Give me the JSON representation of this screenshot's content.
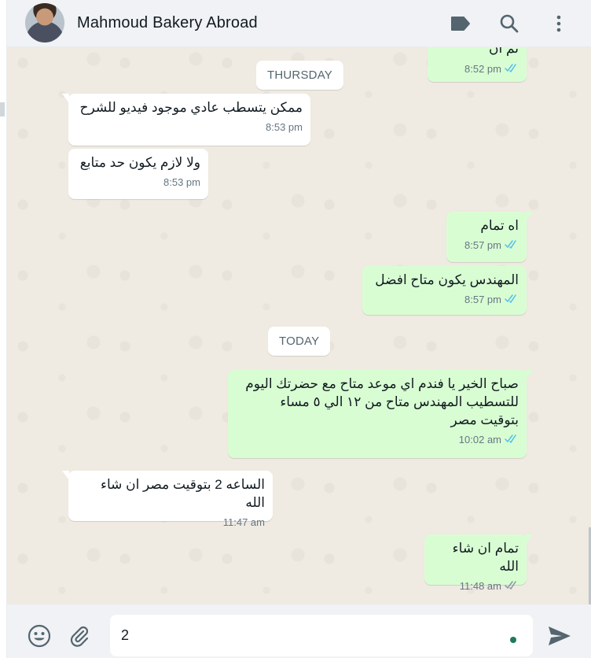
{
  "header": {
    "contact_name": "Mahmoud Bakery Abroad",
    "icons": [
      "label-icon",
      "search-icon",
      "menu-icon"
    ]
  },
  "messages": [
    {
      "direction": "out",
      "text": "تم ان",
      "time": "8:52 pm",
      "ticks": "read",
      "partial": true
    },
    {
      "type": "date",
      "text": "THURSDAY"
    },
    {
      "direction": "in",
      "text": "ممكن يتسطب عادي موجود فيديو للشرح",
      "time": "8:53 pm"
    },
    {
      "direction": "in",
      "text": "ولا لازم يكون حد متابع",
      "time": "8:53 pm"
    },
    {
      "direction": "out",
      "text": "اه تمام",
      "time": "8:57 pm",
      "ticks": "read"
    },
    {
      "direction": "out",
      "text": "المهندس يكون متاح افضل",
      "time": "8:57 pm",
      "ticks": "read"
    },
    {
      "type": "date",
      "text": "TODAY"
    },
    {
      "direction": "out",
      "lines": [
        "صباح الخير يا فندم اي موعد متاح مع حضرتك اليوم",
        "للتسطيب المهندس متاح من ١٢ الي ٥ مساء",
        "بتوقيت مصر"
      ],
      "time": "10:02 am",
      "ticks": "read"
    },
    {
      "direction": "in",
      "text": "الساعه 2 بتوقيت مصر ان شاء الله",
      "time": "11:47 am"
    },
    {
      "direction": "out",
      "text": "تمام ان شاء الله",
      "time": "11:48 am",
      "ticks": "delivered"
    }
  ],
  "composer": {
    "value": "2",
    "icons": [
      "emoji-icon",
      "attach-icon",
      "send-icon"
    ]
  },
  "colors": {
    "incoming": "#ffffff",
    "outgoing": "#d9fdd3",
    "read_tick": "#53bdeb",
    "delivered_tick": "#8696a0",
    "chat_bg": "#efeae2",
    "header_bg": "#f0f2f5"
  }
}
